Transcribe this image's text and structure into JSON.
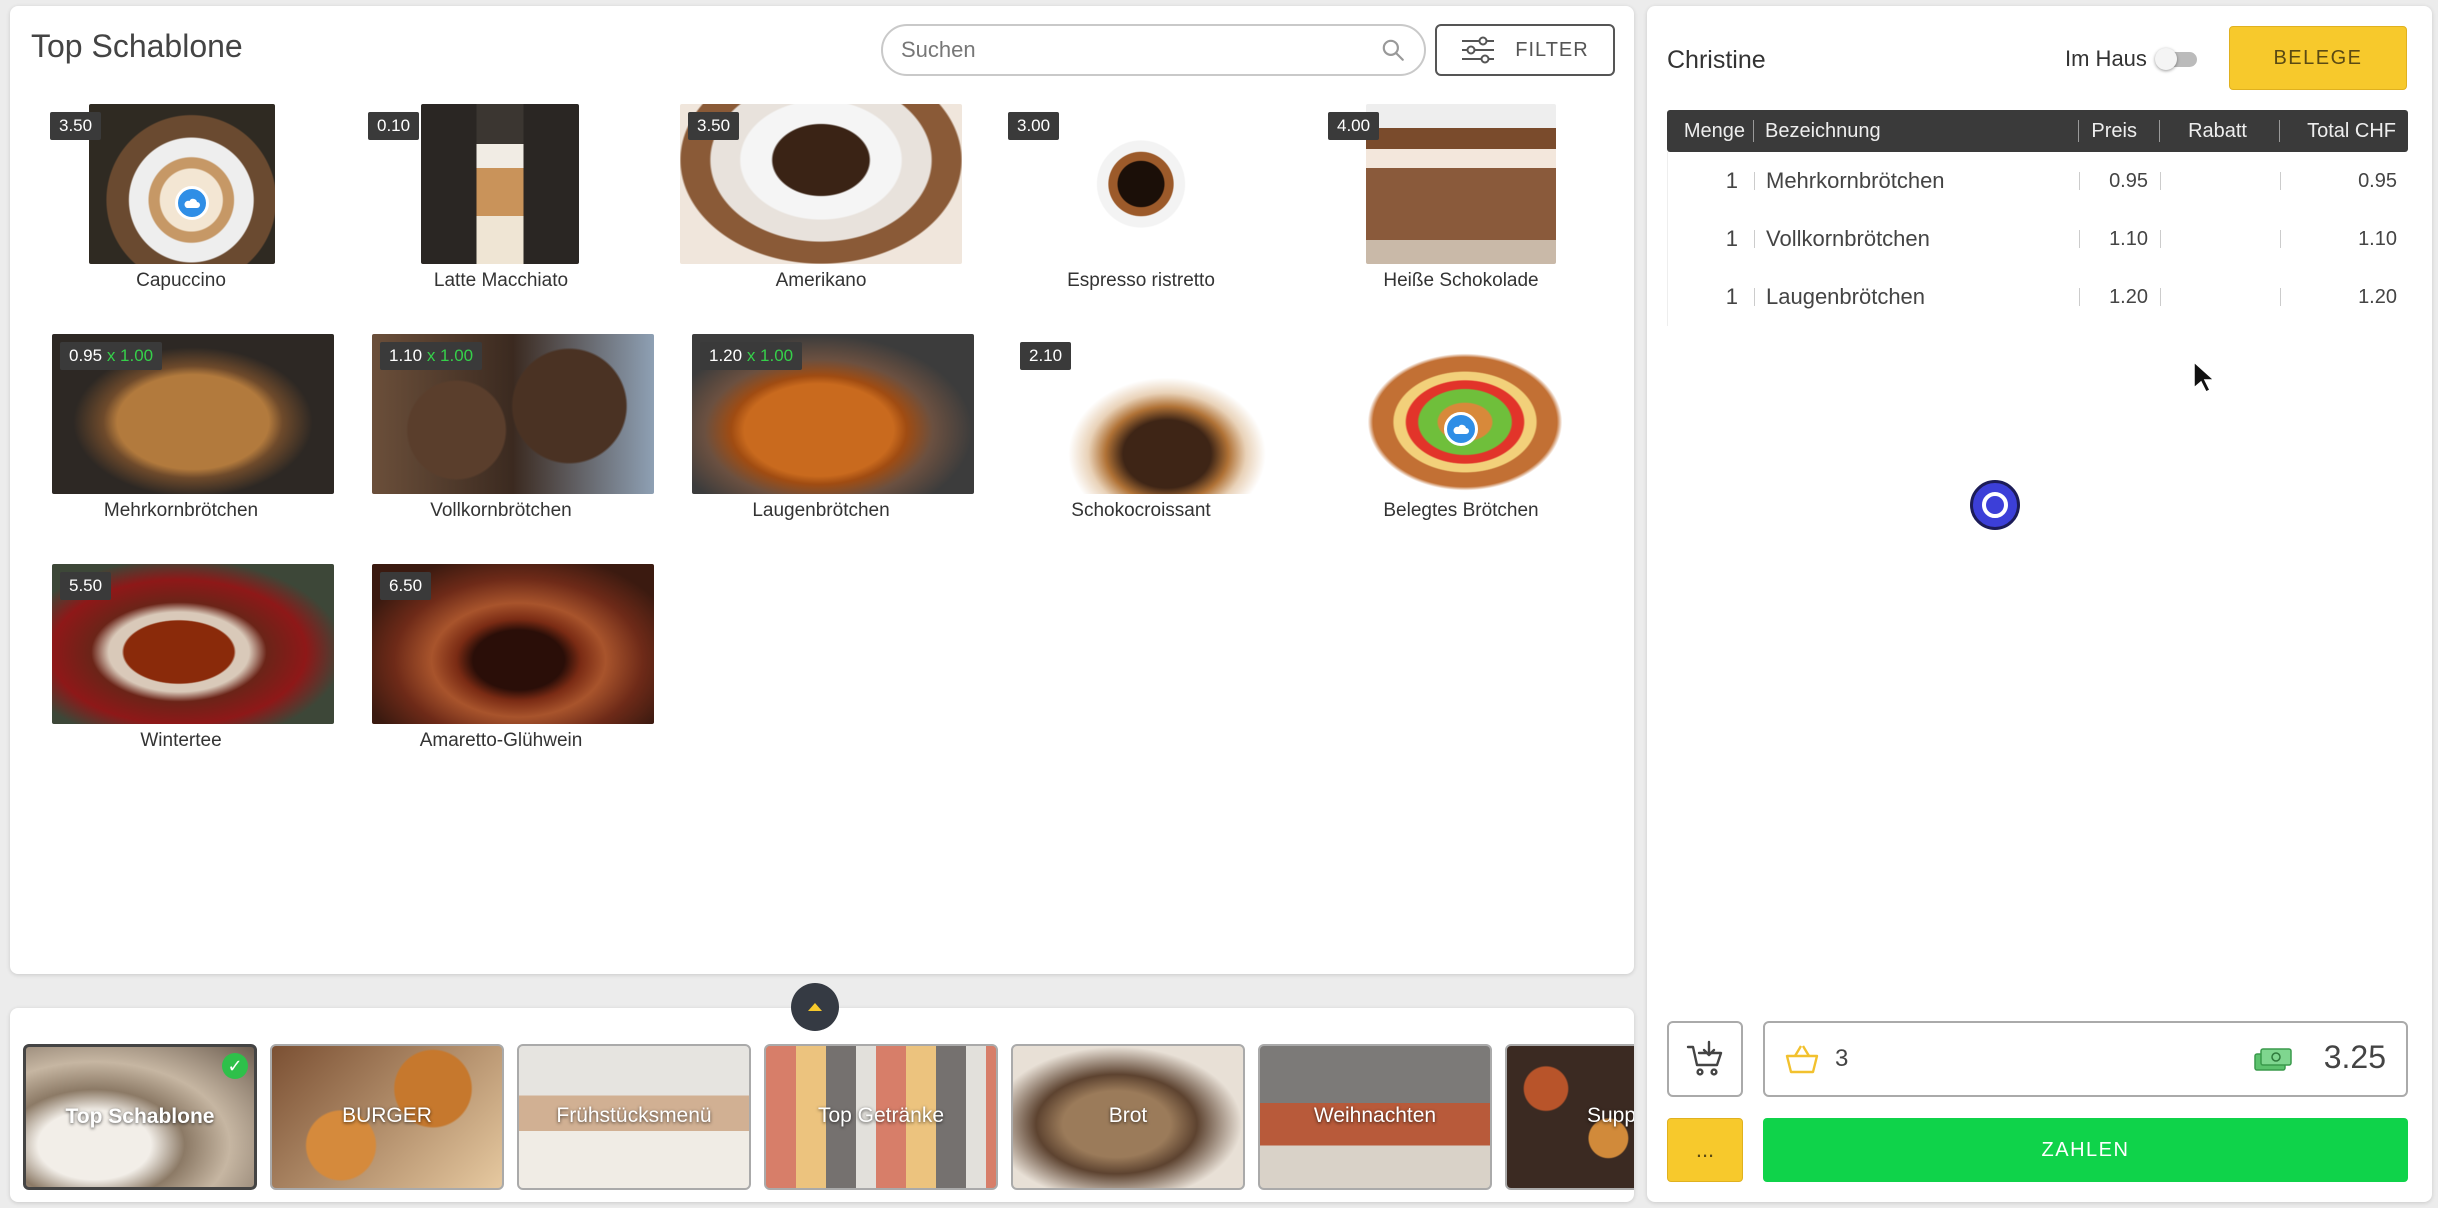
{
  "products_panel": {
    "title": "Top Schablone",
    "search_placeholder": "Suchen",
    "filter_label": "FILTER"
  },
  "products": [
    {
      "name": "Capuccino",
      "price": "3.50",
      "multiplier": "",
      "icon": "cloud-icon"
    },
    {
      "name": "Latte Macchiato",
      "price": "0.10",
      "multiplier": ""
    },
    {
      "name": "Amerikano",
      "price": "3.50",
      "multiplier": ""
    },
    {
      "name": "Espresso ristretto",
      "price": "3.00",
      "multiplier": ""
    },
    {
      "name": "Heiße Schokolade",
      "price": "4.00",
      "multiplier": ""
    },
    {
      "name": "Mehrkornbrötchen",
      "price": "0.95",
      "multiplier": "x 1.00"
    },
    {
      "name": "Vollkornbrötchen",
      "price": "1.10",
      "multiplier": "x 1.00"
    },
    {
      "name": "Laugenbrötchen",
      "price": "1.20",
      "multiplier": "x 1.00"
    },
    {
      "name": "Schokocroissant",
      "price": "2.10",
      "multiplier": ""
    },
    {
      "name": "Belegtes Brötchen",
      "price": "",
      "multiplier": "",
      "icon": "cloud-icon"
    },
    {
      "name": "Wintertee",
      "price": "5.50",
      "multiplier": ""
    },
    {
      "name": "Amaretto-Glühwein",
      "price": "6.50",
      "multiplier": ""
    }
  ],
  "categories": [
    {
      "label": "Top Schablone",
      "active": true
    },
    {
      "label": "BURGER"
    },
    {
      "label": "Frühstücksmenü"
    },
    {
      "label": "Top Getränke"
    },
    {
      "label": "Brot"
    },
    {
      "label": "Weihnachten"
    },
    {
      "label": "Supp"
    }
  ],
  "order_panel": {
    "customer": "Christine",
    "im_haus_label": "Im Haus",
    "im_haus_on": false,
    "belege_label": "BELEGE",
    "columns": {
      "qty": "Menge",
      "name": "Bezeichnung",
      "price": "Preis",
      "discount": "Rabatt",
      "total": "Total CHF"
    },
    "rows": [
      {
        "qty": "1",
        "name": "Mehrkornbrötchen",
        "price": "0.95",
        "discount": "",
        "total": "0.95"
      },
      {
        "qty": "1",
        "name": "Vollkornbrötchen",
        "price": "1.10",
        "discount": "",
        "total": "1.10"
      },
      {
        "qty": "1",
        "name": "Laugenbrötchen",
        "price": "1.20",
        "discount": "",
        "total": "1.20"
      }
    ],
    "item_count": "3",
    "grand_total": "3.25",
    "more_label": "...",
    "pay_label": "ZAHLEN"
  },
  "colors": {
    "accent_yellow": "#f7c92c",
    "pay_green": "#0fd34a",
    "table_header": "#3a3a3a",
    "check_green": "#2ec04a",
    "cloud_blue": "#2f8ee6"
  }
}
